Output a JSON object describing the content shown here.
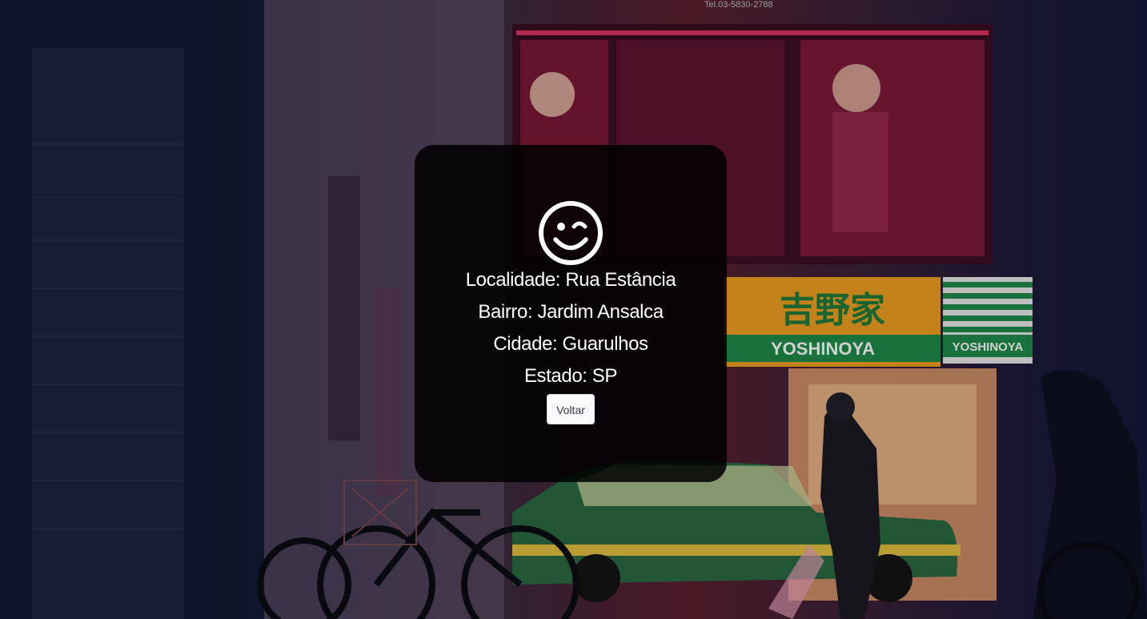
{
  "result": {
    "icon": "smile-wink-icon",
    "localidade": "Localidade: Rua Estância",
    "bairro": "Bairro: Jardim Ansalca",
    "cidade": "Cidade: Guarulhos",
    "estado": "Estado: SP",
    "back_label": "Voltar"
  },
  "background": {
    "sign_main": "吉野家",
    "sign_brand": "YOSHINOYA",
    "sign_brand_small": "YOSHINOYA",
    "phone": "Tel.03-5830-2788"
  },
  "colors": {
    "card_bg": "#000000",
    "text": "#ffffff",
    "button_bg": "#f8f9fa",
    "sign_orange": "#f0a020",
    "sign_green": "#1f8a4a"
  }
}
